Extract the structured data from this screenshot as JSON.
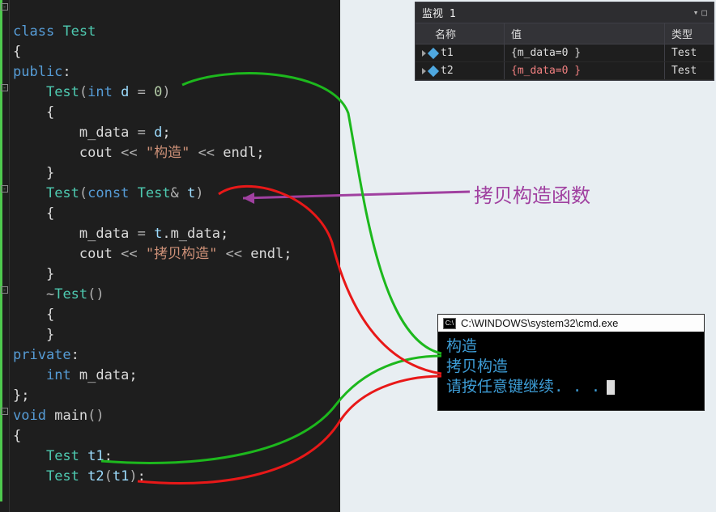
{
  "code": {
    "line1_kw_class": "class",
    "line1_cls": "Test",
    "line2_brace": "{",
    "line3_kw": "public",
    "line3_colon": ":",
    "line4_ctor": "Test",
    "line4_paren_open": "(",
    "line4_type": "int",
    "line4_param": "d",
    "line4_eq": "=",
    "line4_default": "0",
    "line4_paren_close": ")",
    "line5_brace": "{",
    "line6_lhs": "m_data",
    "line6_eq": "=",
    "line6_rhs": "d",
    "line6_semi": ";",
    "line7_cout": "cout",
    "line7_op1": "<<",
    "line7_str": "\"构造\"",
    "line7_op2": "<<",
    "line7_endl": "endl",
    "line7_semi": ";",
    "line8_brace": "}",
    "line9_ctor": "Test",
    "line9_paren_open": "(",
    "line9_const": "const",
    "line9_type": "Test",
    "line9_amp": "&",
    "line9_param": "t",
    "line9_paren_close": ")",
    "line10_brace": "{",
    "line11_lhs": "m_data",
    "line11_eq": "=",
    "line11_rhs_obj": "t",
    "line11_dot": ".",
    "line11_rhs_mem": "m_data",
    "line11_semi": ";",
    "line12_cout": "cout",
    "line12_op1": "<<",
    "line12_str": "\"拷贝构造\"",
    "line12_op2": "<<",
    "line12_endl": "endl",
    "line12_semi": ";",
    "line13_brace": "}",
    "line14_tilde": "~",
    "line14_dtor": "Test",
    "line14_parens": "()",
    "line15_brace": "{",
    "line16_brace": "}",
    "line17_kw": "private",
    "line17_colon": ":",
    "line18_type": "int",
    "line18_member": "m_data",
    "line18_semi": ";",
    "line19_brace": "}",
    "line19_semi": ";",
    "line20_void": "void",
    "line20_main": "main",
    "line20_parens": "()",
    "line21_brace": "{",
    "line22_type": "Test",
    "line22_var": "t1",
    "line22_semi": ";",
    "line23_type": "Test",
    "line23_var": "t2",
    "line23_paren_open": "(",
    "line23_arg": "t1",
    "line23_paren_close": ")",
    "line23_semi": ";"
  },
  "watch": {
    "title": "监视 1",
    "headers": {
      "name": "名称",
      "value": "值",
      "type": "类型"
    },
    "rows": [
      {
        "name": "t1",
        "value": "{m_data=0 }",
        "type": "Test",
        "changed": false
      },
      {
        "name": "t2",
        "value": "{m_data=0 }",
        "type": "Test",
        "changed": true
      }
    ]
  },
  "annotation": {
    "label": "拷贝构造函数"
  },
  "cmd": {
    "title": "C:\\WINDOWS\\system32\\cmd.exe",
    "lines": [
      "构造",
      "拷贝构造",
      "请按任意键继续. . ."
    ]
  }
}
